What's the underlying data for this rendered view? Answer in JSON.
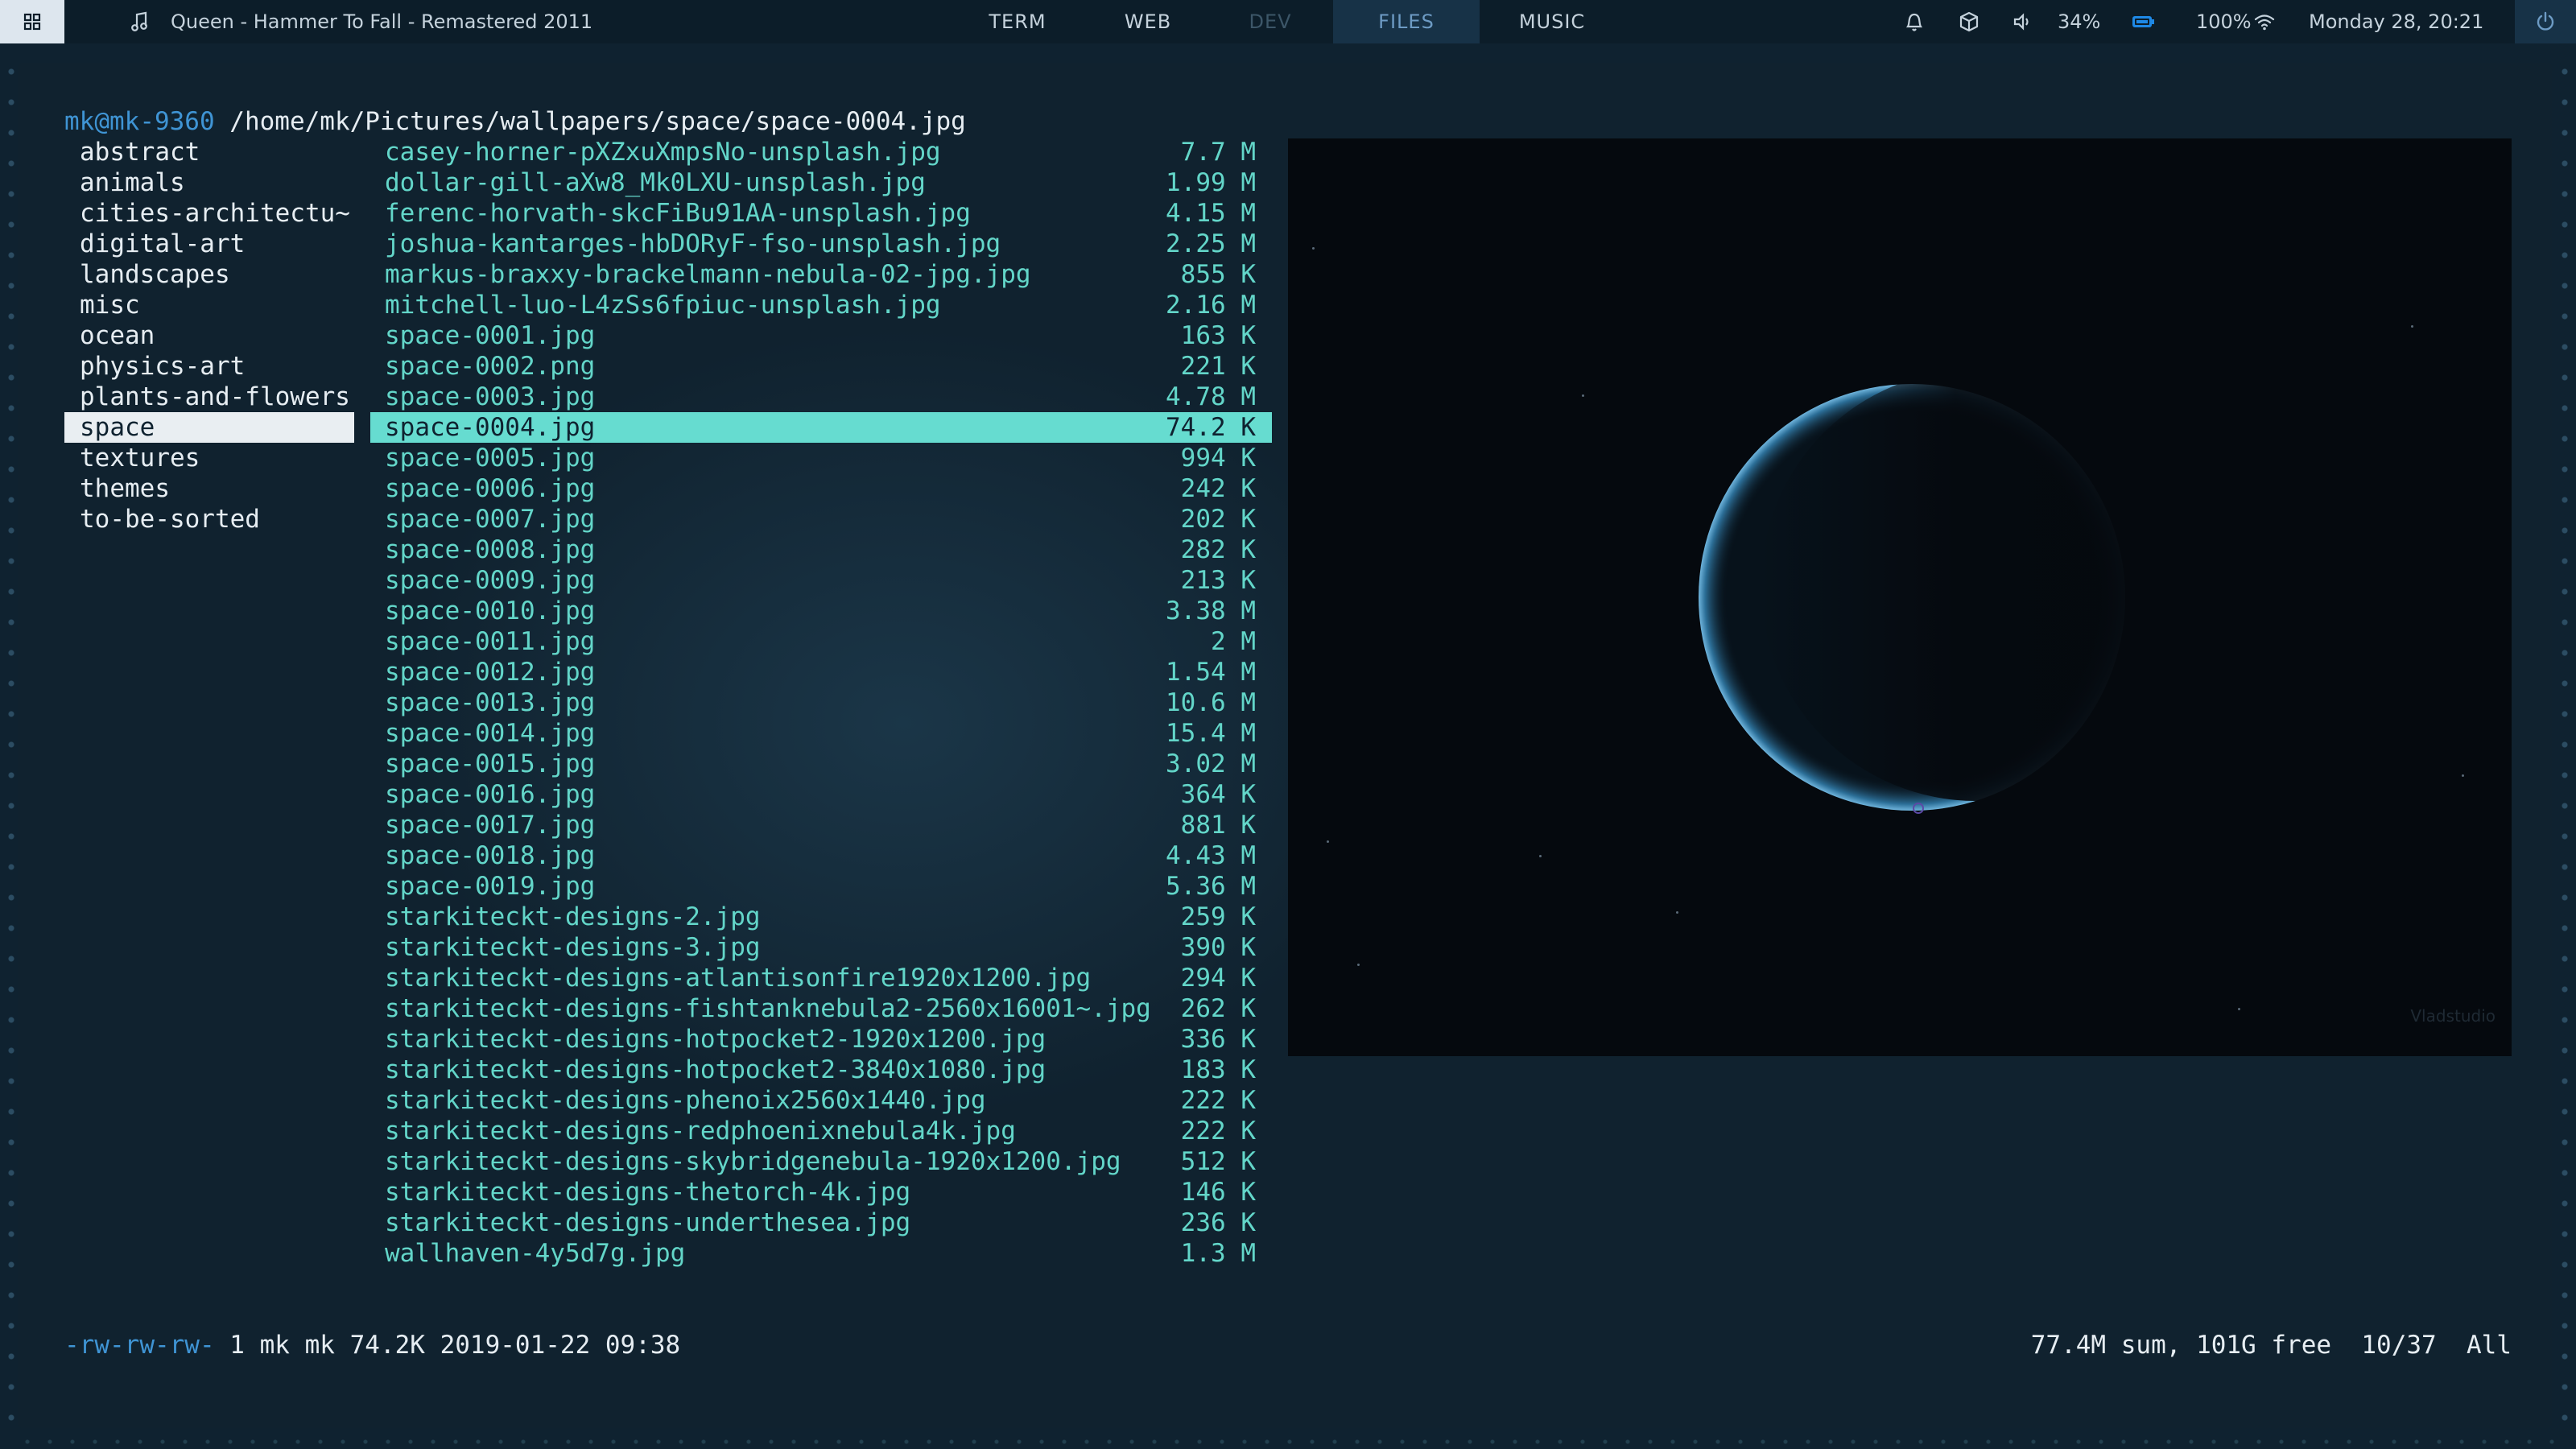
{
  "topbar": {
    "menu_icon": "grid-icon",
    "now_playing_icon": "music-note-icon",
    "now_playing": "Queen - Hammer To Fall - Remastered 2011",
    "tags": [
      {
        "label": "TERM",
        "state": "normal"
      },
      {
        "label": "WEB",
        "state": "normal"
      },
      {
        "label": "DEV",
        "state": "dim"
      },
      {
        "label": "FILES",
        "state": "active"
      },
      {
        "label": "MUSIC",
        "state": "normal"
      }
    ],
    "tray": {
      "bell_icon": "bell-icon",
      "package_icon": "package-icon",
      "volume_icon": "volume-icon",
      "volume": "34%",
      "battery_icon": "battery-icon",
      "battery": "100%",
      "wifi_icon": "wifi-icon",
      "clock": "Monday 28, 20:21",
      "power_icon": "power-icon"
    },
    "colors": {
      "bar_bg": "#0c1d29",
      "active_tag_bg": "#173247",
      "active_tag_fg": "#6d9bc4"
    }
  },
  "terminal": {
    "host": "mk@mk-9360",
    "path": " /home/mk/Pictures/wallpapers/space/space-0004.jpg",
    "directories": [
      "abstract",
      "animals",
      "cities-architectu~",
      "digital-art",
      "landscapes",
      "misc",
      "ocean",
      "physics-art",
      "plants-and-flowers",
      "space",
      "textures",
      "themes",
      "to-be-sorted"
    ],
    "selected_directory": "space",
    "files": [
      {
        "name": "casey-horner-pXZxuXmpsNo-unsplash.jpg",
        "size": "7.7 M"
      },
      {
        "name": "dollar-gill-aXw8_Mk0LXU-unsplash.jpg",
        "size": "1.99 M"
      },
      {
        "name": "ferenc-horvath-skcFiBu91AA-unsplash.jpg",
        "size": "4.15 M"
      },
      {
        "name": "joshua-kantarges-hbDORyF-fso-unsplash.jpg",
        "size": "2.25 M"
      },
      {
        "name": "markus-braxxy-brackelmann-nebula-02-jpg.jpg",
        "size": "855 K"
      },
      {
        "name": "mitchell-luo-L4zSs6fpiuc-unsplash.jpg",
        "size": "2.16 M"
      },
      {
        "name": "space-0001.jpg",
        "size": "163 K"
      },
      {
        "name": "space-0002.png",
        "size": "221 K"
      },
      {
        "name": "space-0003.jpg",
        "size": "4.78 M"
      },
      {
        "name": "space-0004.jpg",
        "size": "74.2 K"
      },
      {
        "name": "space-0005.jpg",
        "size": "994 K"
      },
      {
        "name": "space-0006.jpg",
        "size": "242 K"
      },
      {
        "name": "space-0007.jpg",
        "size": "202 K"
      },
      {
        "name": "space-0008.jpg",
        "size": "282 K"
      },
      {
        "name": "space-0009.jpg",
        "size": "213 K"
      },
      {
        "name": "space-0010.jpg",
        "size": "3.38 M"
      },
      {
        "name": "space-0011.jpg",
        "size": "2 M"
      },
      {
        "name": "space-0012.jpg",
        "size": "1.54 M"
      },
      {
        "name": "space-0013.jpg",
        "size": "10.6 M"
      },
      {
        "name": "space-0014.jpg",
        "size": "15.4 M"
      },
      {
        "name": "space-0015.jpg",
        "size": "3.02 M"
      },
      {
        "name": "space-0016.jpg",
        "size": "364 K"
      },
      {
        "name": "space-0017.jpg",
        "size": "881 K"
      },
      {
        "name": "space-0018.jpg",
        "size": "4.43 M"
      },
      {
        "name": "space-0019.jpg",
        "size": "5.36 M"
      },
      {
        "name": "starkiteckt-designs-2.jpg",
        "size": "259 K"
      },
      {
        "name": "starkiteckt-designs-3.jpg",
        "size": "390 K"
      },
      {
        "name": "starkiteckt-designs-atlantisonfire1920x1200.jpg",
        "size": "294 K"
      },
      {
        "name": "starkiteckt-designs-fishtanknebula2-2560x16001~.jpg",
        "size": "262 K"
      },
      {
        "name": "starkiteckt-designs-hotpocket2-1920x1200.jpg",
        "size": "336 K"
      },
      {
        "name": "starkiteckt-designs-hotpocket2-3840x1080.jpg",
        "size": "183 K"
      },
      {
        "name": "starkiteckt-designs-phenoix2560x1440.jpg",
        "size": "222 K"
      },
      {
        "name": "starkiteckt-designs-redphoenixnebula4k.jpg",
        "size": "222 K"
      },
      {
        "name": "starkiteckt-designs-skybridgenebula-1920x1200.jpg",
        "size": "512 K"
      },
      {
        "name": "starkiteckt-designs-thetorch-4k.jpg",
        "size": "146 K"
      },
      {
        "name": "starkiteckt-designs-underthesea.jpg",
        "size": "236 K"
      },
      {
        "name": "wallhaven-4y5d7g.jpg",
        "size": "1.3 M"
      }
    ],
    "selected_file": "space-0004.jpg",
    "preview_watermark": "Vladstudio",
    "status": {
      "permissions": "-rw-rw-rw-",
      "file_info": " 1 mk mk 74.2K 2019-01-22 09:38",
      "summary": "77.4M sum, 101G free  10/37  All"
    },
    "colors": {
      "dir_fg": "#e6edf2",
      "file_fg": "#63d6c9",
      "file_sel_bg": "#66dcd0",
      "host_fg": "#3f94d4"
    }
  }
}
